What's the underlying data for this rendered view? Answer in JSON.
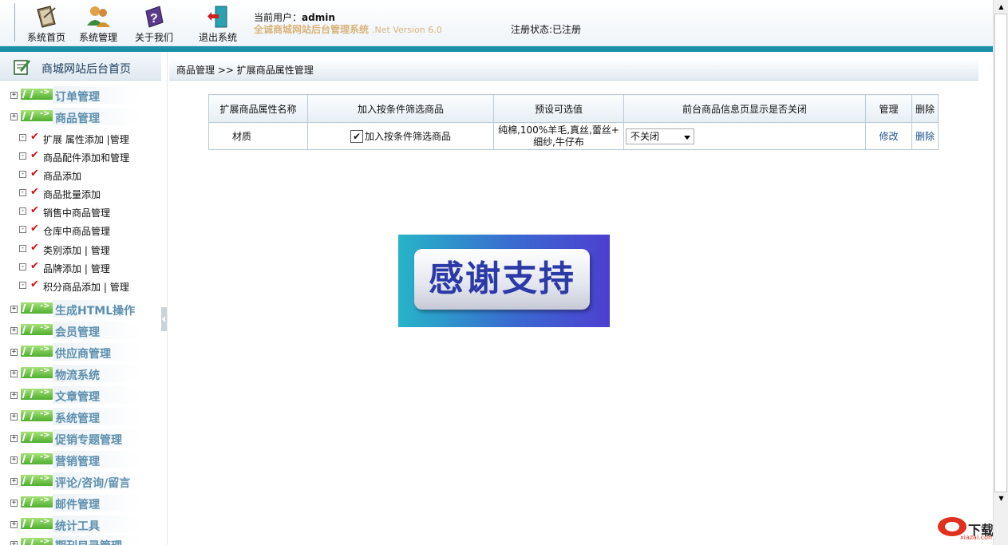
{
  "header": {
    "nav": [
      {
        "label": "系统首页",
        "icon": "home-icon"
      },
      {
        "label": "系统管理",
        "icon": "users-icon"
      },
      {
        "label": "关于我们",
        "icon": "help-book-icon"
      },
      {
        "label": "退出系统",
        "icon": "exit-door-icon"
      }
    ],
    "current_user_label": "当前用户：",
    "current_user": "admin",
    "system_name": "全诚商城网站后台管理系统",
    "version": ".Net Version 6.0",
    "registration_status": "注册状态:已注册"
  },
  "sidebar": {
    "title": "商城网站后台首页",
    "categories_before": [
      {
        "label": "订单管理",
        "toggle": "+"
      },
      {
        "label": "商品管理",
        "toggle": "+"
      }
    ],
    "product_subitems": [
      {
        "label": "扩展 属性添加",
        "link2": "管理"
      },
      {
        "label": "商品配件添加和管理"
      },
      {
        "label": "商品添加"
      },
      {
        "label": "商品批量添加"
      },
      {
        "label": "销售中商品管理"
      },
      {
        "label": "仓库中商品管理"
      },
      {
        "label": "类别添加",
        "link2": "管理"
      },
      {
        "label": "品牌添加",
        "link2": "管理"
      },
      {
        "label": "积分商品添加",
        "link2": "管理"
      }
    ],
    "categories_after": [
      {
        "label": "生成HTML操作",
        "toggle": "+"
      },
      {
        "label": "会员管理",
        "toggle": "+"
      },
      {
        "label": "供应商管理",
        "toggle": "+"
      },
      {
        "label": "物流系统",
        "toggle": "+"
      },
      {
        "label": "文章管理",
        "toggle": "+"
      },
      {
        "label": "系统管理",
        "toggle": "+"
      },
      {
        "label": "促销专题管理",
        "toggle": "+"
      },
      {
        "label": "营销管理",
        "toggle": "+"
      },
      {
        "label": "评论/咨询/留言",
        "toggle": "+"
      },
      {
        "label": "邮件管理",
        "toggle": "+"
      },
      {
        "label": "统计工具",
        "toggle": "+"
      },
      {
        "label": "期刊目录管理",
        "toggle": "+"
      }
    ],
    "sub_toggle": "-",
    "sep": "|"
  },
  "breadcrumb": "商品管理 >> 扩展商品属性管理",
  "table": {
    "headers": [
      "扩展商品属性名称",
      "加入按条件筛选商品",
      "预设可选值",
      "前台商品信息页显示是否关闭",
      "管理",
      "删除"
    ],
    "rows": [
      {
        "name": "材质",
        "filter_checked": true,
        "filter_label": "加入按条件筛选商品",
        "preset_values_line1": "纯棉,100%羊毛,真丝,蕾丝+",
        "preset_values_line2": "细纱,牛仔布",
        "display_closed": "不关闭",
        "edit_label": "修改",
        "delete_label": "删除"
      }
    ]
  },
  "banner": {
    "text": "感谢支持"
  },
  "watermark": {
    "text": "下载",
    "url_text": "xiazai.com"
  },
  "colors": {
    "accent_teal": "#1a90a8",
    "category_text": "#5c8fae",
    "link": "#1a4f8c",
    "check_red": "#d01010"
  }
}
